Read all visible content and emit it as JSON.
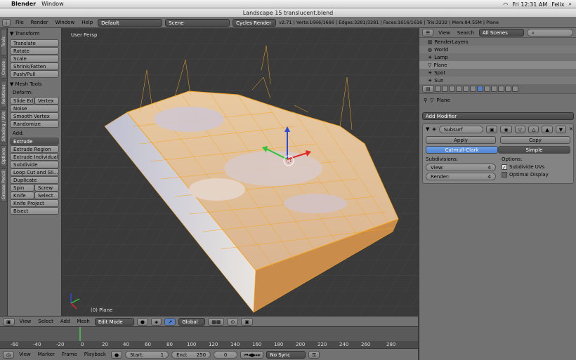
{
  "mac": {
    "apple": "",
    "app": "Blender",
    "menu": [
      "Window"
    ],
    "right": [
      "Fri 12:31 AM",
      "Felix"
    ]
  },
  "window_title": "Landscape 15 translucent.blend",
  "info": {
    "menus": [
      "File",
      "Render",
      "Window",
      "Help"
    ],
    "layout": "Default",
    "scene": "Scene",
    "engine": "Cycles Render",
    "stats": "v2.71 | Verts:1666/1666 | Edges:3281/3281 | Faces:1616/1616 | Tris:3232 | Mem:84.55M | Plane"
  },
  "tabs": [
    "Tools",
    "Create",
    "Relations",
    "Shading / UVs",
    "Options",
    "Grease Pencil"
  ],
  "shelf": {
    "transform_header": "Transform",
    "transform": [
      "Translate",
      "Rotate",
      "Scale",
      "Shrink/Fatten",
      "Push/Pull"
    ],
    "mesh_tools_header": "Mesh Tools",
    "deform_label": "Deform:",
    "slide_edge": "Slide Ed",
    "vertex": "Vertex",
    "deform": [
      "Noise",
      "Smooth Vertex",
      "Randomize"
    ],
    "add_label": "Add:",
    "extrude": "Extrude",
    "add": [
      "Extrude Region",
      "Extrude Individual",
      "Subdivide",
      "Loop Cut and Sli...",
      "Duplicate"
    ],
    "spin": "Spin",
    "screw": "Screw",
    "knife": "Knife",
    "select": "Select",
    "more": [
      "Knife Project",
      "Bisect"
    ]
  },
  "viewport": {
    "label": "User Persp",
    "object": "(0) Plane"
  },
  "view_header": {
    "menus": [
      "View",
      "Select",
      "Add",
      "Mesh"
    ],
    "mode": "Edit Mode",
    "orientation": "Global"
  },
  "timeline": {
    "ticks": [
      "-60",
      "-40",
      "-20",
      "0",
      "20",
      "40",
      "60",
      "80",
      "100",
      "120",
      "140",
      "160",
      "180",
      "200",
      "220",
      "240",
      "260",
      "280"
    ],
    "menus": [
      "View",
      "Marker",
      "Frame",
      "Playback"
    ],
    "start_label": "Start:",
    "start": "1",
    "end_label": "End:",
    "end": "250",
    "current": "0",
    "sync": "No Sync"
  },
  "outliner": {
    "menus": [
      "View",
      "Search"
    ],
    "scenes": "All Scenes",
    "items": [
      "RenderLayers",
      "World",
      "Lamp",
      "Plane",
      "Spot",
      "Sun"
    ]
  },
  "properties": {
    "object": "Plane",
    "add_modifier": "Add Modifier",
    "modifier_name": "Subsurf",
    "apply": "Apply",
    "copy": "Copy",
    "catmull": "Catmull-Clark",
    "simple": "Simple",
    "subdivisions": "Subdivisions:",
    "view_label": "View:",
    "view_value": "4",
    "render_label": "Render:",
    "render_value": "4",
    "options": "Options:",
    "subdivide_uvs": "Subdivide UVs",
    "optimal_display": "Optimal Display"
  },
  "colors": {
    "accent": "#5680c2",
    "wire": "#f5a623",
    "mesh": "#c9c9d8"
  }
}
